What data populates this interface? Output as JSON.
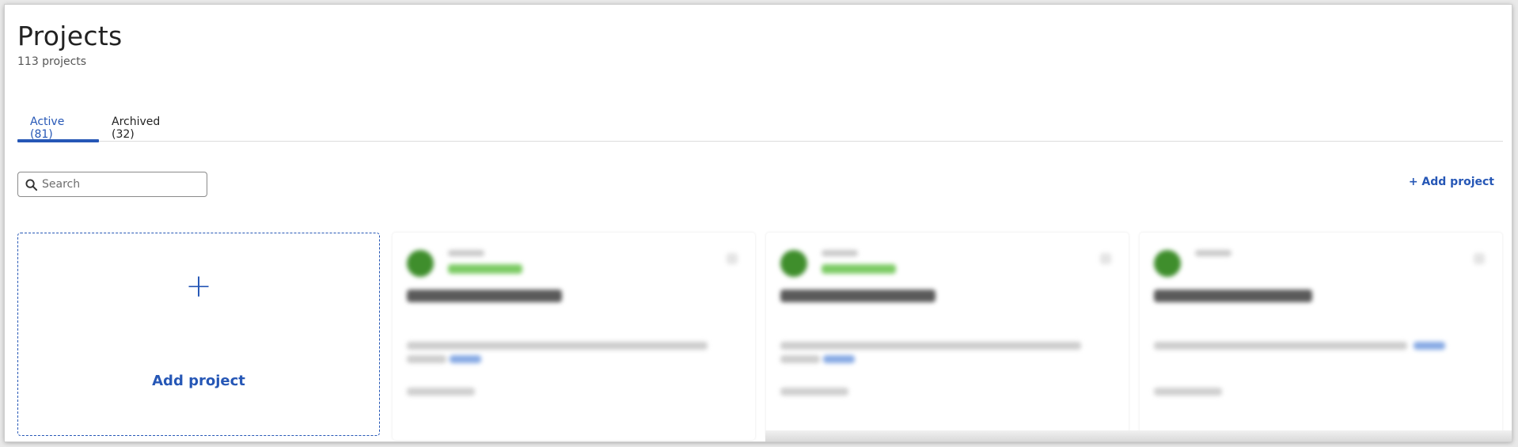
{
  "header": {
    "title": "Projects",
    "subtitle": "113 projects"
  },
  "tabs": [
    {
      "label": "Active (81)",
      "active": true
    },
    {
      "label": "Archived (32)",
      "active": false
    }
  ],
  "search": {
    "placeholder": "Search",
    "value": ""
  },
  "toolbar": {
    "add_project_label": "+ Add project"
  },
  "add_card": {
    "plus": "+",
    "label": "Add project"
  },
  "colors": {
    "accent": "#2657b6",
    "avatar": "#3f8e2c",
    "status": "#7ccb64"
  },
  "icons": {
    "search": "search-icon",
    "plus": "plus-icon",
    "card_menu": "kebab-menu-icon"
  }
}
